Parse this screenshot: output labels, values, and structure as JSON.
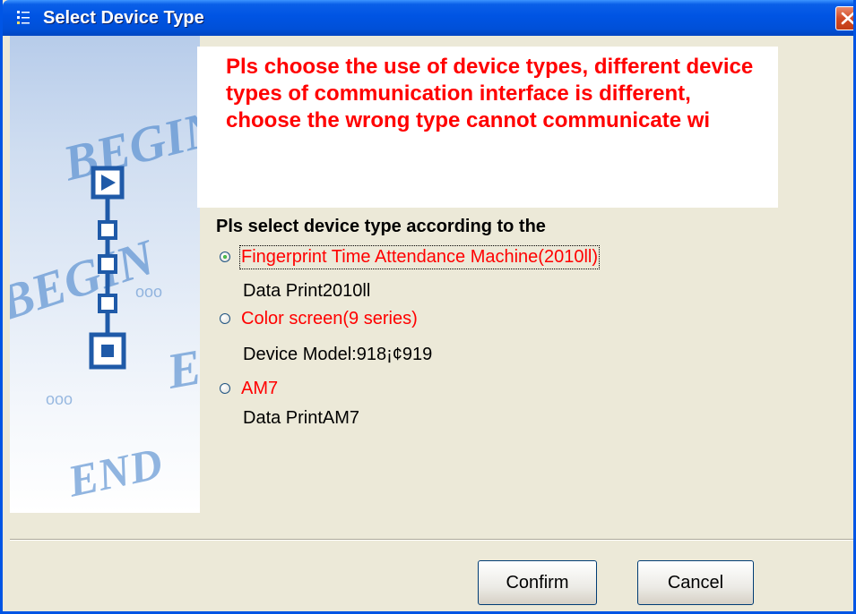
{
  "window": {
    "title": "Select Device Type",
    "title_icon": "app-icon",
    "close_icon": "close-icon",
    "colors": {
      "titlebar": "#0054e3",
      "frame": "#0055e5",
      "dialog_bg": "#ece9d8",
      "close": "#d24a24"
    }
  },
  "banner": {
    "words": [
      "BEGIN",
      "BEGIN",
      "E",
      "END"
    ],
    "dots": [
      "ooo",
      "ooo"
    ],
    "steps_icon": "wizard-steps-icon",
    "colors": {
      "steps": "#1f5aa8",
      "lettering": "#3a7bc8"
    }
  },
  "message": {
    "text": "Pls choose the use of device types, different device types of communication interface is different, choose the wrong type cannot communicate wi",
    "color": "#ff0000"
  },
  "prompt": "Pls select device type according to the",
  "options": [
    {
      "label": "Fingerprint Time Attendance Machine(2010ll)",
      "description": "Data Print2010ll",
      "selected": true
    },
    {
      "label": "Color screen(9 series)",
      "description": "Device Model:918¡¢919",
      "selected": false
    },
    {
      "label": "AM7",
      "description": "Data PrintAM7",
      "selected": false
    }
  ],
  "buttons": {
    "confirm": "Confirm",
    "cancel": "Cancel"
  }
}
